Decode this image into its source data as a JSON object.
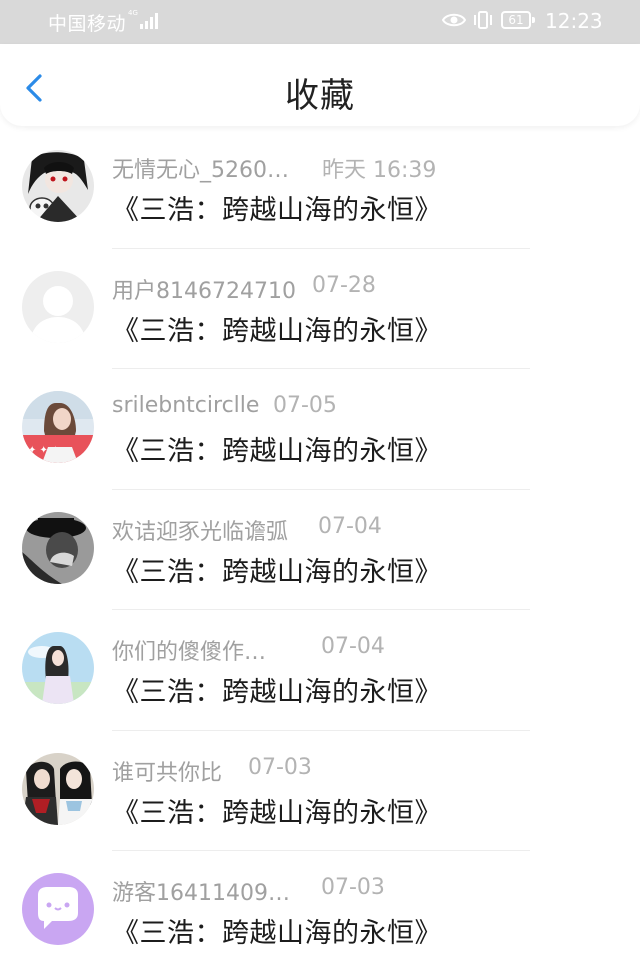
{
  "status_bar": {
    "carrier": "中国移动",
    "network_tag": "4G",
    "battery": "61",
    "time": "12:23",
    "icons": [
      "signal-icon",
      "eye-icon",
      "vibrate-icon",
      "battery-icon"
    ]
  },
  "header": {
    "back_icon": "chevron-left-icon",
    "title": "收藏"
  },
  "colors": {
    "accent": "#2b8be8",
    "username": "#a0a0a0",
    "date": "#b3b3b3",
    "title": "#1c1c1c",
    "divider": "#ededed"
  },
  "items": [
    {
      "username": "无情无心_5260…",
      "date": "昨天 16:39",
      "title": "《三浩：跨越山海的永恒》",
      "avatar": "avatar-dark-anime-skull"
    },
    {
      "username": "用户8146724710",
      "date": "07-28",
      "title": "《三浩：跨越山海的永恒》",
      "avatar": "avatar-default-person"
    },
    {
      "username": "srilebntcirclle",
      "date": "07-05",
      "title": "《三浩：跨越山海的永恒》",
      "avatar": "avatar-girl-photo"
    },
    {
      "username": "欢诘迎豕光临谵弧",
      "date": "07-04",
      "title": "《三浩：跨越山海的永恒》",
      "avatar": "avatar-bw-hat"
    },
    {
      "username": "你们的傻傻作…",
      "date": "07-04",
      "title": "《三浩：跨越山海的永恒》",
      "avatar": "avatar-anime-girl-sky"
    },
    {
      "username": "谁可共你比",
      "date": "07-03",
      "title": "《三浩：跨越山海的永恒》",
      "avatar": "avatar-two-anime-boys"
    },
    {
      "username": "游客16411409…",
      "date": "07-03",
      "title": "《三浩：跨越山海的永恒》",
      "avatar": "avatar-purple-chat"
    }
  ]
}
